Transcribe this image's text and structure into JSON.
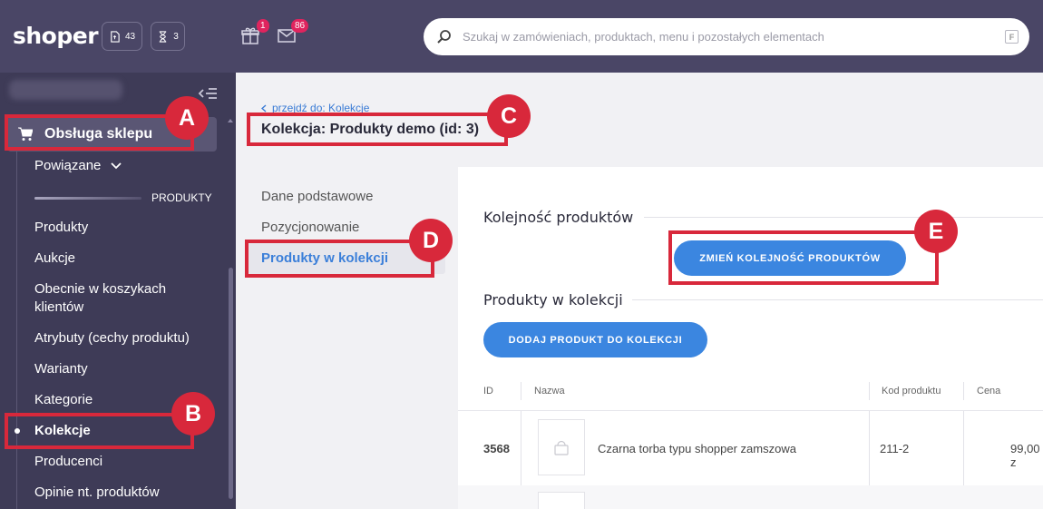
{
  "header": {
    "logo": "shoper",
    "orders_count": "43",
    "pending_count": "3",
    "gift_badge": "1",
    "mail_badge": "86",
    "search_placeholder": "Szukaj w zamówieniach, produktach, menu i pozostałych elementach",
    "search_shortcut": "F"
  },
  "sidebar": {
    "main_item": "Obsługa sklepu",
    "related": "Powiązane",
    "section_heading": "PRODUKTY",
    "items": [
      "Produkty",
      "Aukcje",
      "Obecnie w koszykach klientów",
      "Atrybuty (cechy produktu)",
      "Warianty",
      "Kategorie",
      "Kolekcje",
      "Producenci",
      "Opinie nt. produktów"
    ],
    "active_item": "Kolekcje"
  },
  "content": {
    "breadcrumb": "przejdź do: Kolekcje",
    "title": "Kolekcja: Produkty demo (id: 3)",
    "subnav": [
      "Dane podstawowe",
      "Pozycjonowanie",
      "Produkty w kolekcji"
    ],
    "subnav_active": "Produkty w kolekcji",
    "order_section": "Kolejność produktów",
    "order_button": "ZMIEŃ KOLEJNOŚĆ PRODUKTÓW",
    "products_section": "Produkty w kolekcji",
    "add_button": "DODAJ PRODUKT DO KOLEKCJI",
    "table": {
      "columns": [
        "ID",
        "Nazwa",
        "Kod produktu",
        "Cena"
      ],
      "rows": [
        {
          "id": "3568",
          "name": "Czarna torba typu shopper zamszowa",
          "code": "211-2",
          "price": "99,00 z"
        }
      ]
    }
  },
  "annotations": [
    "A",
    "B",
    "C",
    "D",
    "E"
  ],
  "colors": {
    "topbar": "#4a4666",
    "sidebar": "#3e3b57",
    "accent": "#3b86e0",
    "annotation": "#d8283b",
    "badge": "#e0245e"
  }
}
